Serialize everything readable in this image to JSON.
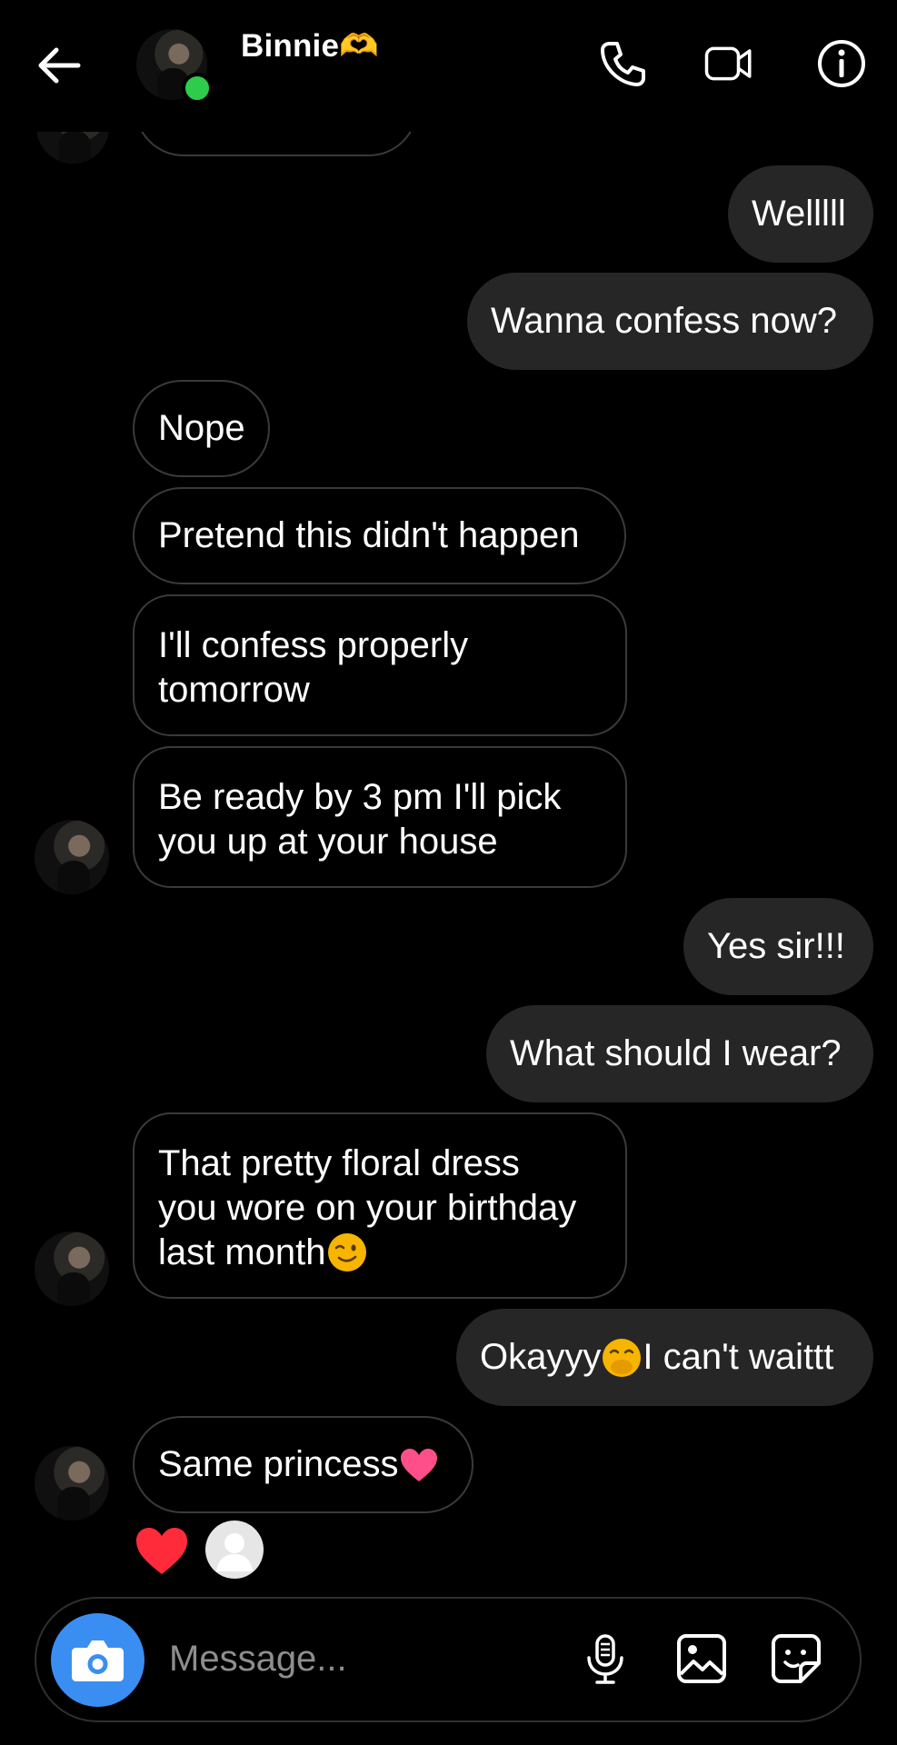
{
  "header": {
    "contact_name": "Binnie🫶",
    "online": true
  },
  "messages": [
    {
      "side": "out",
      "text": "Welllll"
    },
    {
      "side": "out",
      "text": "Wanna confess now?"
    },
    {
      "side": "in",
      "text": "Nope"
    },
    {
      "side": "in",
      "text": "Pretend this didn't happen"
    },
    {
      "side": "in",
      "lines": [
        "I'll confess properly",
        "tomorrow"
      ]
    },
    {
      "side": "in",
      "lines": [
        "Be ready by 3 pm I'll pick",
        "you up at your house"
      ]
    },
    {
      "side": "out",
      "text": "Yes sir!!!"
    },
    {
      "side": "out",
      "text": "What should I wear?"
    },
    {
      "side": "in",
      "lines": [
        "That pretty floral dress",
        "you wore on your birthday",
        "last month"
      ],
      "emoji": "wink-emoji"
    },
    {
      "side": "out",
      "text_before": "Okayyy",
      "emoji": "face-with-hand-over-mouth-emoji",
      "text_after": "I can't waittt"
    },
    {
      "side": "in",
      "text": "Same princess",
      "emoji": "pink-heart-emoji"
    }
  ],
  "reaction": {
    "emoji": "red-heart",
    "reactor": "default-avatar"
  },
  "composer": {
    "placeholder": "Message..."
  },
  "colors": {
    "background": "#000000",
    "outgoing_bubble": "#262626",
    "incoming_border": "#3a3a3a",
    "camera_button": "#3a8ef2",
    "online_dot": "#2ecc4a"
  },
  "icons": [
    "back-arrow-icon",
    "phone-icon",
    "video-call-icon",
    "info-icon",
    "camera-icon",
    "microphone-icon",
    "gallery-icon",
    "sticker-icon"
  ]
}
